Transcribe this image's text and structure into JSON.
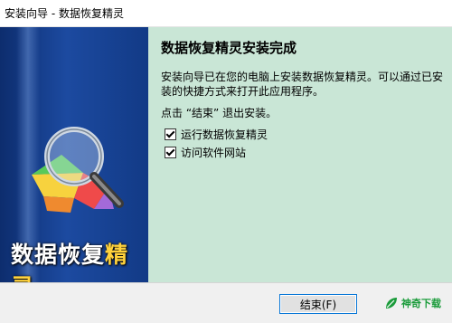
{
  "window": {
    "title": "安装向导 - 数据恢复精灵"
  },
  "sidebar": {
    "brand_main": "数据恢复",
    "brand_highlight": "精灵"
  },
  "content": {
    "heading": "数据恢复精灵安装完成",
    "description": "安装向导已在您的电脑上安装数据恢复精灵。可以通过已安装的快捷方式来打开此应用程序。",
    "exit_hint": "点击 “结束” 退出安装。",
    "options": [
      {
        "label": "运行数据恢复精灵",
        "checked": true
      },
      {
        "label": "访问软件网站",
        "checked": true
      }
    ]
  },
  "footer": {
    "finish_label": "结束(F)",
    "watermark_text": "神奇下载",
    "watermark_color": "#1a9b3a"
  }
}
